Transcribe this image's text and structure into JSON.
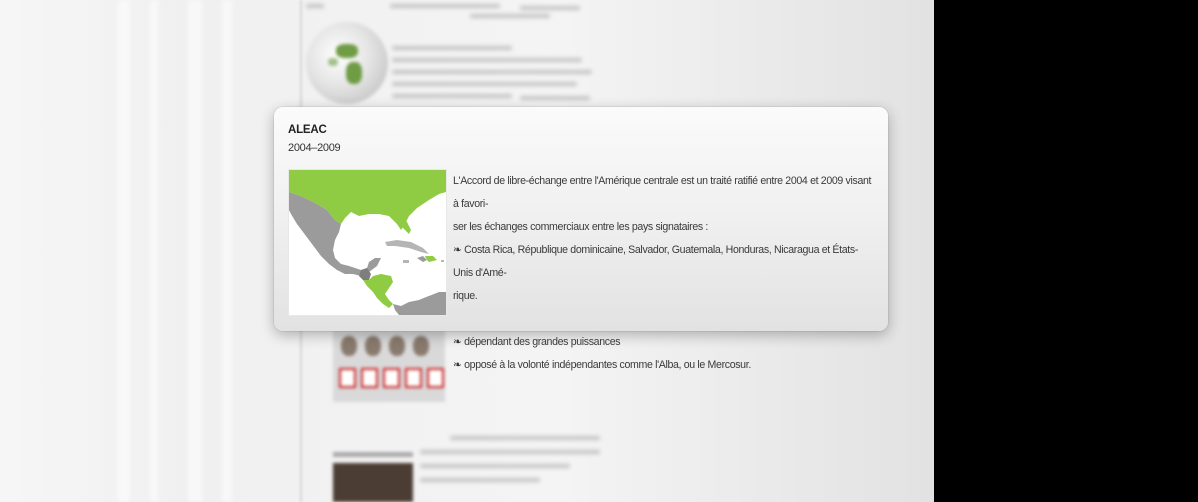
{
  "popup": {
    "title": "ALEAC",
    "years": "2004–2009",
    "description": "L'Accord de libre-échange entre l'Amérique centrale est un traité ratifié entre 2004 et 2009 visant à favori-ser les échanges commerciaux entre les pays signataires :",
    "desc_line1": "L'Accord de libre-échange entre l'Amérique centrale est un traité ratifié entre 2004 et 2009 visant à favori-",
    "desc_line2": "ser les échanges commerciaux entre les pays signataires :",
    "members_line1": "❧ Costa Rica, République dominicaine, Salvador, Guatemala, Honduras, Nicaragua et États-Unis d'Amé-",
    "members_line2": "rique.",
    "point1": "❧ dépendant des grandes puissances",
    "point2": "❧ opposé à la volonté indépendantes comme l'Alba, ou le Mercosur."
  },
  "map_colors": {
    "member": "#8fcc43",
    "non_member": "#9b9b9b",
    "sea": "#ffffff"
  }
}
